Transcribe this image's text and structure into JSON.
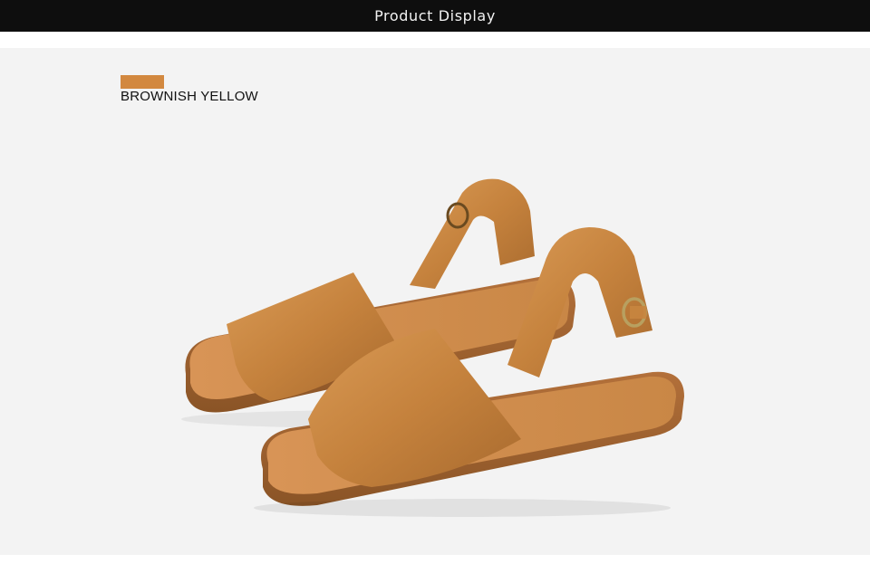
{
  "header": {
    "title": "Product Display",
    "background": "#0e0e0e",
    "text_color": "#f2f2f2"
  },
  "panel": {
    "background": "#f3f3f3"
  },
  "swatch": {
    "label": "BROWNISH YELLOW",
    "color": "#d2883f"
  },
  "product": {
    "image_kind": "sandals-photo",
    "leather_color": "#c8853f",
    "sole_color": "#a8642e",
    "buckle_color": "#b8a060"
  }
}
